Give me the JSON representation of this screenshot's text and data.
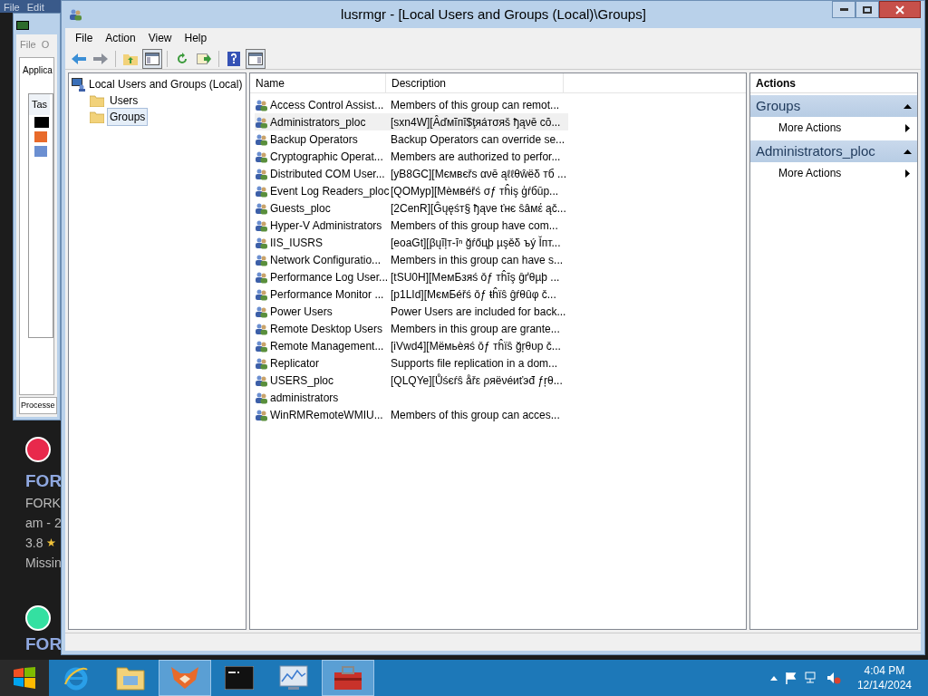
{
  "behind_window": {
    "menu": [
      "File",
      "Edit"
    ]
  },
  "task_manager": {
    "menu": [
      "File",
      "O"
    ],
    "tab": "Applica",
    "column": "Tas",
    "tab_2": "Processe"
  },
  "web_page": {
    "items": [
      {
        "kind": "logo",
        "color": "#e8294c"
      },
      {
        "kind": "title",
        "text": "FOR"
      },
      {
        "kind": "text",
        "text": "FORK"
      },
      {
        "kind": "text",
        "text": "am - 2"
      },
      {
        "kind": "rating",
        "text": "3.8"
      },
      {
        "kind": "text",
        "text": "Missin"
      },
      {
        "kind": "logo",
        "color": "#34e0a1"
      },
      {
        "kind": "title",
        "text": "FOR"
      }
    ]
  },
  "window": {
    "title": "lusrmgr - [Local Users and Groups (Local)\\Groups]"
  },
  "menu": [
    "File",
    "Action",
    "View",
    "Help"
  ],
  "toolbar": [
    {
      "kind": "back",
      "pressed": false
    },
    {
      "kind": "forward",
      "pressed": false
    },
    {
      "kind": "sep"
    },
    {
      "kind": "up",
      "pressed": false
    },
    {
      "kind": "tree",
      "pressed": true
    },
    {
      "kind": "sep"
    },
    {
      "kind": "refresh",
      "pressed": false
    },
    {
      "kind": "export",
      "pressed": false
    },
    {
      "kind": "sep"
    },
    {
      "kind": "help",
      "pressed": false
    },
    {
      "kind": "pane",
      "pressed": true
    }
  ],
  "tree": {
    "label": "Local Users and Groups (Local)",
    "children": [
      {
        "label": "Users",
        "selected": false
      },
      {
        "label": "Groups",
        "selected": true
      }
    ]
  },
  "table": {
    "columns": [
      "Name",
      "Description"
    ],
    "rows": [
      {
        "name": "Access Control Assist...",
        "description": "Members of this group can remot...",
        "selected": false
      },
      {
        "name": "Administrators_ploc",
        "description": "[sxn4W][Ȃďмĩпĭ$ţяáтσяš ђąνē cŏ...",
        "selected": true
      },
      {
        "name": "Backup Operators",
        "description": "Backup Operators can override se...",
        "selected": false
      },
      {
        "name": "Cryptographic Operat...",
        "description": "Members are authorized to perfor...",
        "selected": false
      },
      {
        "name": "Distributed COM User...",
        "description": "[yB8GC][Мємвєřѕ ανē ąℓℓθŵëδ тб ...",
        "selected": false
      },
      {
        "name": "Event Log Readers_ploc",
        "description": "[QOMyp][Мèмвéřś σƒ тĥіş ģŕбūр...",
        "selected": false
      },
      {
        "name": "Guests_ploc",
        "description": "[2CenR][Ĝųęśт§ ђąνе ťнє ŝâмέ ąč...",
        "selected": false
      },
      {
        "name": "Hyper-V Administrators",
        "description": "Members of this group have com...",
        "selected": false
      },
      {
        "name": "IIS_IUSRS",
        "description": "[eoaGt][βųĩļт-ĭⁿ ğŕőцþ µşěδ ъý Ĭпт...",
        "selected": false
      },
      {
        "name": "Network Configuratio...",
        "description": "Members in this group can have s...",
        "selected": false
      },
      {
        "name": "Performance Log User...",
        "description": "[tSU0H][МемБзяś ǒƒ тĥĭş ĝґθµþ ...",
        "selected": false
      },
      {
        "name": "Performance Monitor ...",
        "description": "[p1LId][МємБéřś ǒƒ ŧĥïŝ ĝŕθûφ č...",
        "selected": false
      },
      {
        "name": "Power Users",
        "description": "Power Users are included for back...",
        "selected": false
      },
      {
        "name": "Remote Desktop Users",
        "description": "Members in this group are grante...",
        "selected": false
      },
      {
        "name": "Remote Management...",
        "description": "[iVwd4][Мёмьèяś ǒƒ тĥïŝ ğŗθυр č...",
        "selected": false
      },
      {
        "name": "Replicator",
        "description": "Supports file replication in a dom...",
        "selected": false
      },
      {
        "name": "USERS_ploc",
        "description": "[QLQYe][Ůśєŕŝ åřε ρяëνéиťэđ ƒŗθ...",
        "selected": false
      },
      {
        "name": "administrators",
        "selected": false
      },
      {
        "name": "WinRMRemoteWMIU...",
        "description": "Members of this group can acces...",
        "selected": false
      }
    ]
  },
  "actions": {
    "title": "Actions",
    "sections": [
      {
        "title": "Groups",
        "expanded": true,
        "items": [
          "More Actions"
        ]
      },
      {
        "title": "Administrators_ploc",
        "expanded": true,
        "items": [
          "More Actions"
        ]
      }
    ]
  },
  "taskbar": {
    "apps": [
      {
        "kind": "ie",
        "active": false
      },
      {
        "kind": "explorer",
        "active": false
      },
      {
        "kind": "fox",
        "active": true
      },
      {
        "kind": "cmd",
        "active": false
      },
      {
        "kind": "monitor",
        "active": false
      },
      {
        "kind": "toolbox",
        "active": true
      }
    ],
    "time": "4:04 PM",
    "date": "12/14/2024"
  }
}
